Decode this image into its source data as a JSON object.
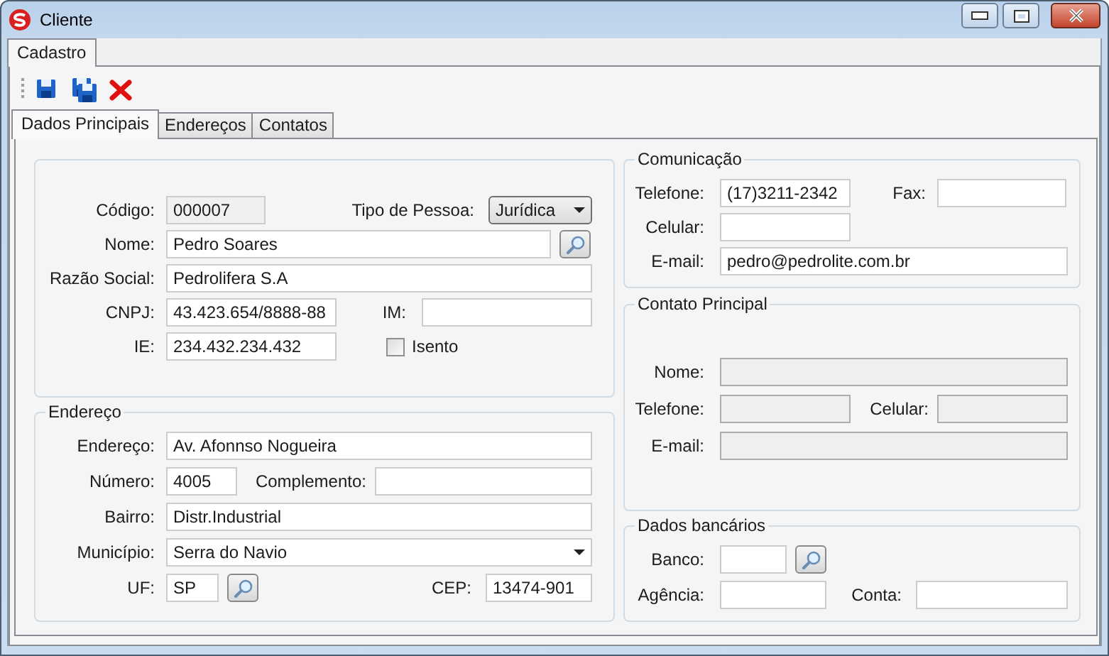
{
  "window": {
    "title": "Cliente"
  },
  "outer_tabs": [
    {
      "label": "Cadastro",
      "selected": true
    }
  ],
  "toolbar": [
    {
      "kind": "save"
    },
    {
      "kind": "save_all"
    },
    {
      "kind": "delete"
    }
  ],
  "tabs": [
    {
      "label": "Dados Principais",
      "selected": true
    },
    {
      "label": "Endereços",
      "selected": false
    },
    {
      "label": "Contatos",
      "selected": false
    }
  ],
  "panel": {
    "left": [
      {
        "rows": [
          [
            {
              "kind": "text",
              "label": "Código:",
              "value": "000007",
              "disabled": true
            },
            {
              "kind": "dropdown",
              "label": "Tipo de Pessoa:",
              "value": "Jurídica",
              "disabled": false
            }
          ],
          [
            {
              "kind": "text",
              "label": "Nome:",
              "value": "Pedro Soares",
              "disabled": false
            },
            {
              "kind": "lookup"
            }
          ],
          [
            {
              "kind": "text",
              "label": "Razão Social:",
              "value": "Pedrolifera S.A",
              "disabled": false
            }
          ],
          [
            {
              "kind": "text",
              "label": "CNPJ:",
              "value": "43.423.654/8888-88",
              "disabled": false
            },
            {
              "kind": "text",
              "label": "IM:",
              "disabled": false
            }
          ],
          [
            {
              "kind": "text",
              "label": "IE:",
              "value": "234.432.234.432",
              "disabled": false
            },
            {
              "kind": "checkbox",
              "label": "Isento",
              "checked": false
            }
          ]
        ]
      },
      {
        "title": "Endereço",
        "rows": [
          [
            {
              "kind": "text",
              "label": "Endereço:",
              "value": "Av. Afonnso Nogueira",
              "disabled": false
            }
          ],
          [
            {
              "kind": "text",
              "label": "Número:",
              "value": "4005",
              "disabled": false
            },
            {
              "kind": "text",
              "label": "Complemento:",
              "disabled": false
            }
          ],
          [
            {
              "kind": "text",
              "label": "Bairro:",
              "value": "Distr.Industrial",
              "disabled": false
            }
          ],
          [
            {
              "kind": "combo",
              "label": "Município:",
              "value": "Serra do Navio",
              "disabled": false
            }
          ],
          [
            {
              "kind": "text",
              "label": "UF:",
              "value": "SP",
              "disabled": false
            },
            {
              "kind": "lookup"
            },
            {
              "kind": "text",
              "label": "CEP:",
              "value": "13474-901",
              "disabled": false
            }
          ]
        ]
      }
    ],
    "right": [
      {
        "title": "Comunicação",
        "rows": [
          [
            {
              "kind": "text",
              "label": "Telefone:",
              "value": "(17)3211-2342",
              "disabled": false
            },
            {
              "kind": "text",
              "label": "Fax:",
              "disabled": false
            }
          ],
          [
            {
              "kind": "text",
              "label": "Celular:",
              "disabled": false
            }
          ],
          [
            {
              "kind": "text",
              "label": "E-mail:",
              "value": "pedro@pedrolite.com.br",
              "disabled": false
            }
          ]
        ]
      },
      {
        "title": "Contato Principal",
        "rows": [
          [
            {
              "kind": "text",
              "label": "Nome:",
              "disabled": true
            }
          ],
          [
            {
              "kind": "text",
              "label": "Telefone:",
              "disabled": true
            },
            {
              "kind": "text",
              "label": "Celular:",
              "disabled": true
            }
          ],
          [
            {
              "kind": "text",
              "label": "E-mail:",
              "disabled": true
            }
          ]
        ]
      },
      {
        "title": "Dados bancários",
        "rows": [
          [
            {
              "kind": "text",
              "label": "Banco:",
              "disabled": false
            },
            {
              "kind": "lookup"
            }
          ],
          [
            {
              "kind": "text",
              "label": "Agência:",
              "disabled": false
            },
            {
              "kind": "text",
              "label": "Conta:",
              "disabled": false
            }
          ]
        ]
      }
    ]
  }
}
